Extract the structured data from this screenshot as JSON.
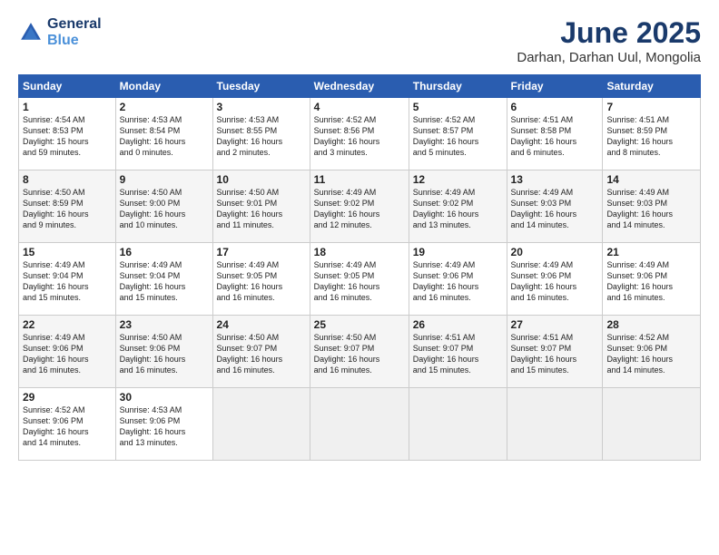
{
  "logo": {
    "line1": "General",
    "line2": "Blue"
  },
  "title": "June 2025",
  "subtitle": "Darhan, Darhan Uul, Mongolia",
  "days_header": [
    "Sunday",
    "Monday",
    "Tuesday",
    "Wednesday",
    "Thursday",
    "Friday",
    "Saturday"
  ],
  "weeks": [
    [
      {
        "num": "1",
        "sunrise": "4:54 AM",
        "sunset": "8:53 PM",
        "daylight": "15 hours and 59 minutes."
      },
      {
        "num": "2",
        "sunrise": "4:53 AM",
        "sunset": "8:54 PM",
        "daylight": "16 hours and 0 minutes."
      },
      {
        "num": "3",
        "sunrise": "4:53 AM",
        "sunset": "8:55 PM",
        "daylight": "16 hours and 2 minutes."
      },
      {
        "num": "4",
        "sunrise": "4:52 AM",
        "sunset": "8:56 PM",
        "daylight": "16 hours and 3 minutes."
      },
      {
        "num": "5",
        "sunrise": "4:52 AM",
        "sunset": "8:57 PM",
        "daylight": "16 hours and 5 minutes."
      },
      {
        "num": "6",
        "sunrise": "4:51 AM",
        "sunset": "8:58 PM",
        "daylight": "16 hours and 6 minutes."
      },
      {
        "num": "7",
        "sunrise": "4:51 AM",
        "sunset": "8:59 PM",
        "daylight": "16 hours and 8 minutes."
      }
    ],
    [
      {
        "num": "8",
        "sunrise": "4:50 AM",
        "sunset": "8:59 PM",
        "daylight": "16 hours and 9 minutes."
      },
      {
        "num": "9",
        "sunrise": "4:50 AM",
        "sunset": "9:00 PM",
        "daylight": "16 hours and 10 minutes."
      },
      {
        "num": "10",
        "sunrise": "4:50 AM",
        "sunset": "9:01 PM",
        "daylight": "16 hours and 11 minutes."
      },
      {
        "num": "11",
        "sunrise": "4:49 AM",
        "sunset": "9:02 PM",
        "daylight": "16 hours and 12 minutes."
      },
      {
        "num": "12",
        "sunrise": "4:49 AM",
        "sunset": "9:02 PM",
        "daylight": "16 hours and 13 minutes."
      },
      {
        "num": "13",
        "sunrise": "4:49 AM",
        "sunset": "9:03 PM",
        "daylight": "16 hours and 14 minutes."
      },
      {
        "num": "14",
        "sunrise": "4:49 AM",
        "sunset": "9:03 PM",
        "daylight": "16 hours and 14 minutes."
      }
    ],
    [
      {
        "num": "15",
        "sunrise": "4:49 AM",
        "sunset": "9:04 PM",
        "daylight": "16 hours and 15 minutes."
      },
      {
        "num": "16",
        "sunrise": "4:49 AM",
        "sunset": "9:04 PM",
        "daylight": "16 hours and 15 minutes."
      },
      {
        "num": "17",
        "sunrise": "4:49 AM",
        "sunset": "9:05 PM",
        "daylight": "16 hours and 16 minutes."
      },
      {
        "num": "18",
        "sunrise": "4:49 AM",
        "sunset": "9:05 PM",
        "daylight": "16 hours and 16 minutes."
      },
      {
        "num": "19",
        "sunrise": "4:49 AM",
        "sunset": "9:06 PM",
        "daylight": "16 hours and 16 minutes."
      },
      {
        "num": "20",
        "sunrise": "4:49 AM",
        "sunset": "9:06 PM",
        "daylight": "16 hours and 16 minutes."
      },
      {
        "num": "21",
        "sunrise": "4:49 AM",
        "sunset": "9:06 PM",
        "daylight": "16 hours and 16 minutes."
      }
    ],
    [
      {
        "num": "22",
        "sunrise": "4:49 AM",
        "sunset": "9:06 PM",
        "daylight": "16 hours and 16 minutes."
      },
      {
        "num": "23",
        "sunrise": "4:50 AM",
        "sunset": "9:06 PM",
        "daylight": "16 hours and 16 minutes."
      },
      {
        "num": "24",
        "sunrise": "4:50 AM",
        "sunset": "9:07 PM",
        "daylight": "16 hours and 16 minutes."
      },
      {
        "num": "25",
        "sunrise": "4:50 AM",
        "sunset": "9:07 PM",
        "daylight": "16 hours and 16 minutes."
      },
      {
        "num": "26",
        "sunrise": "4:51 AM",
        "sunset": "9:07 PM",
        "daylight": "16 hours and 15 minutes."
      },
      {
        "num": "27",
        "sunrise": "4:51 AM",
        "sunset": "9:07 PM",
        "daylight": "16 hours and 15 minutes."
      },
      {
        "num": "28",
        "sunrise": "4:52 AM",
        "sunset": "9:06 PM",
        "daylight": "16 hours and 14 minutes."
      }
    ],
    [
      {
        "num": "29",
        "sunrise": "4:52 AM",
        "sunset": "9:06 PM",
        "daylight": "16 hours and 14 minutes."
      },
      {
        "num": "30",
        "sunrise": "4:53 AM",
        "sunset": "9:06 PM",
        "daylight": "16 hours and 13 minutes."
      },
      null,
      null,
      null,
      null,
      null
    ]
  ],
  "labels": {
    "sunrise": "Sunrise:",
    "sunset": "Sunset:",
    "daylight": "Daylight hours"
  }
}
